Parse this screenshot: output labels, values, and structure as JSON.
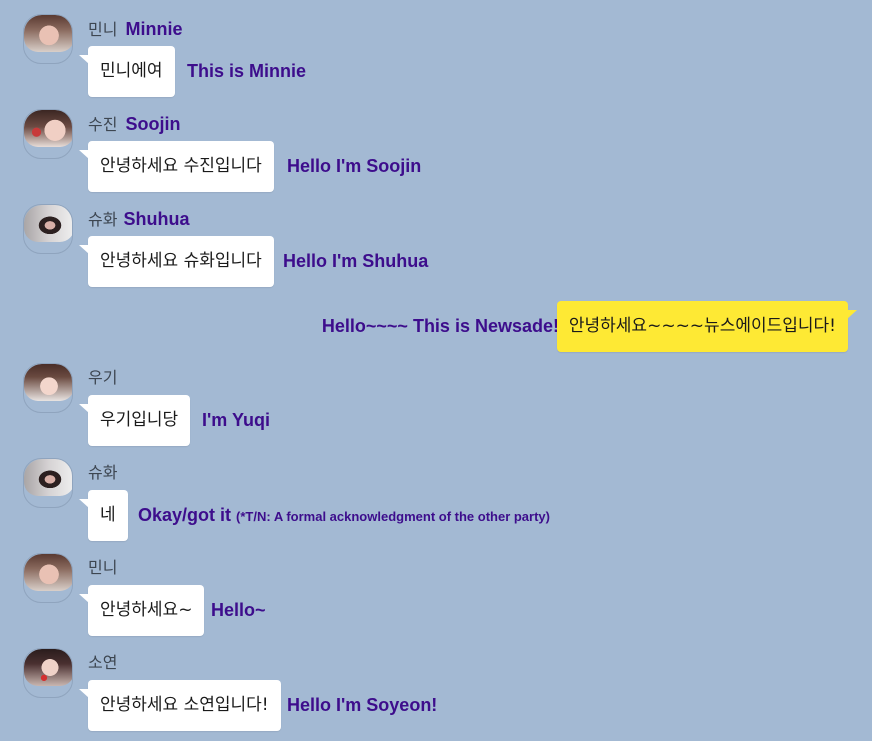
{
  "colors": {
    "background": "#a3b9d3",
    "incoming_bubble": "#ffffff",
    "outgoing_bubble": "#fee934",
    "translation_text": "#3d0d8c",
    "sender_name_ko": "#3d4651"
  },
  "messages": [
    {
      "type": "incoming",
      "avatar": "minnie-profile-photo",
      "sender_ko": "민니",
      "sender_en": "Minnie",
      "text": "민니에여",
      "translation": "This is Minnie"
    },
    {
      "type": "incoming",
      "avatar": "soojin-profile-photo",
      "sender_ko": "수진",
      "sender_en": "Soojin",
      "text": "안녕하세요 수진입니다",
      "translation": "Hello I'm Soojin"
    },
    {
      "type": "incoming",
      "avatar": "shuhua-profile-photo",
      "sender_ko": "슈화",
      "sender_en": "Shuhua",
      "text": "안녕하세요 슈화입니다",
      "translation": "Hello I'm Shuhua"
    },
    {
      "type": "outgoing",
      "text": "안녕하세요~~~~뉴스에이드입니다!",
      "translation": "Hello~~~~ This is Newsade!"
    },
    {
      "type": "incoming",
      "avatar": "yuqi-profile-photo",
      "sender_ko": "우기",
      "sender_en": "",
      "text": "우기입니당",
      "translation": "I'm Yuqi"
    },
    {
      "type": "incoming",
      "avatar": "shuhua-profile-photo",
      "sender_ko": "슈화",
      "sender_en": "",
      "text": "네",
      "translation": "Okay/got it",
      "note": "(*T/N: A formal acknowledgment of the other party)"
    },
    {
      "type": "incoming",
      "avatar": "minnie-profile-photo",
      "sender_ko": "민니",
      "sender_en": "",
      "text": "안녕하세요~",
      "translation": "Hello~"
    },
    {
      "type": "incoming",
      "avatar": "soyeon-profile-photo",
      "sender_ko": "소연",
      "sender_en": "",
      "text": "안녕하세요 소연입니다!",
      "translation": "Hello I'm Soyeon!"
    }
  ]
}
